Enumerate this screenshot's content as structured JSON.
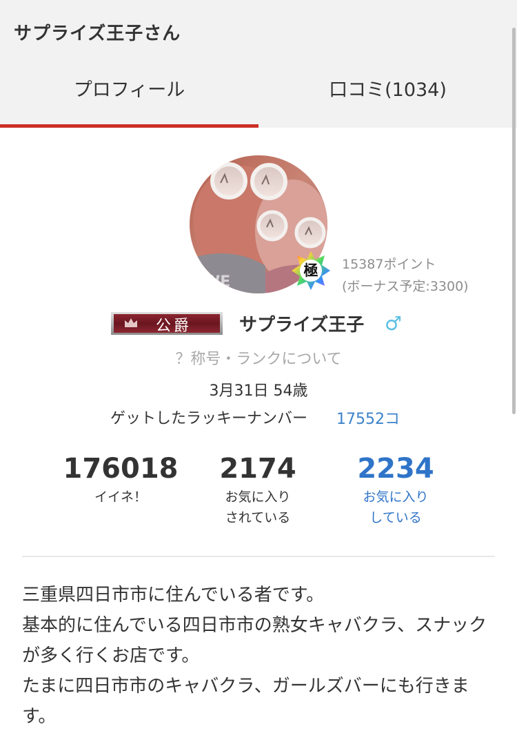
{
  "header": {
    "title": "サプライズ王子さん"
  },
  "tabs": [
    {
      "label": "プロフィール",
      "active": true
    },
    {
      "label": "口コミ(1034)",
      "active": false
    }
  ],
  "profile": {
    "rank_badge": "極",
    "points": "15387ポイント",
    "bonus": "(ボーナス予定:3300)",
    "title_badge": "公爵",
    "name": "サプライズ王子",
    "gender_icon": "male-icon",
    "rank_help_link": "？称号・ランクについて",
    "birth_age": "3月31日 54歳",
    "lucky_label": "ゲットしたラッキーナンバー",
    "lucky_value": "17552コ"
  },
  "stats": [
    {
      "value": "176018",
      "label_lines": [
        "イイネ！"
      ]
    },
    {
      "value": "2174",
      "label_lines": [
        "お気に入り",
        "されている"
      ]
    },
    {
      "value": "2234",
      "label_lines": [
        "お気に入り",
        "している"
      ]
    }
  ],
  "intro": [
    "三重県四日市市に住んでいる者です。",
    "基本的に住んでいる四日市市の熟女キャバクラ、スナックが多く行くお店です。",
    "たまに四日市市のキャバクラ、ガールズバーにも行きます。"
  ],
  "colors": {
    "accent_red": "#cc2f27",
    "link_blue": "#2f74c8",
    "gender_blue": "#5bbfe3",
    "header_bg": "#f2f2f2"
  }
}
